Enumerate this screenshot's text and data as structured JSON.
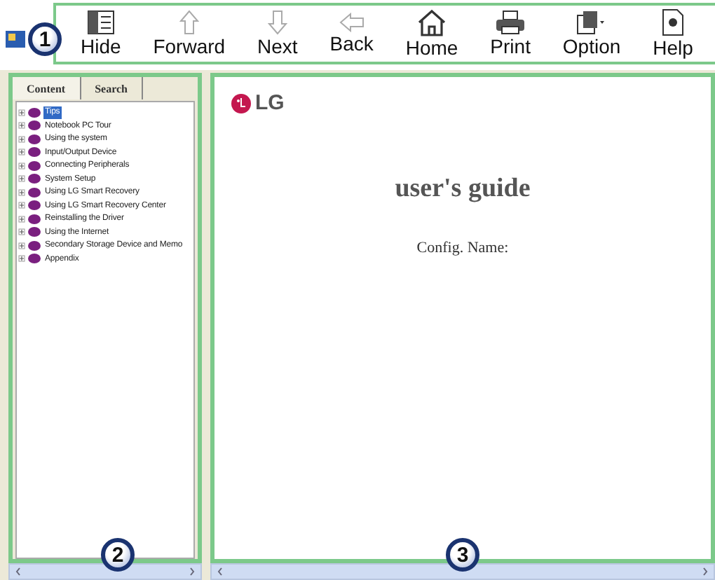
{
  "toolbar": [
    {
      "label": "Hide",
      "kind": "hide",
      "disabled": false
    },
    {
      "label": "Forward",
      "kind": "up",
      "disabled": true
    },
    {
      "label": "Next",
      "kind": "down",
      "disabled": true
    },
    {
      "label": "Back",
      "kind": "left",
      "disabled": true
    },
    {
      "label": "Home",
      "kind": "home",
      "disabled": false
    },
    {
      "label": "Print",
      "kind": "print",
      "disabled": false
    },
    {
      "label": "Option",
      "kind": "option",
      "disabled": false
    },
    {
      "label": "Help",
      "kind": "help",
      "disabled": false
    }
  ],
  "callouts": [
    "1",
    "2",
    "3"
  ],
  "tabs": [
    {
      "label": "Content",
      "selected": true
    },
    {
      "label": "Search",
      "selected": false
    }
  ],
  "tree": [
    {
      "label": "Tips",
      "selected": true
    },
    {
      "label": "Notebook PC Tour",
      "selected": false
    },
    {
      "label": "Using the system",
      "selected": false
    },
    {
      "label": "Input/Output Device",
      "selected": false
    },
    {
      "label": "Connecting Peripherals",
      "selected": false
    },
    {
      "label": "System Setup",
      "selected": false
    },
    {
      "label": "Using LG Smart Recovery",
      "selected": false
    },
    {
      "label": "Using LG Smart Recovery Center",
      "selected": false
    },
    {
      "label": "Reinstalling the Driver",
      "selected": false
    },
    {
      "label": "Using the Internet",
      "selected": false
    },
    {
      "label": "Secondary Storage Device and Memo",
      "selected": false
    },
    {
      "label": "Appendix",
      "selected": false
    }
  ],
  "document": {
    "logo": "LG",
    "title": "user's guide",
    "subtitle": "Config. Name:"
  }
}
